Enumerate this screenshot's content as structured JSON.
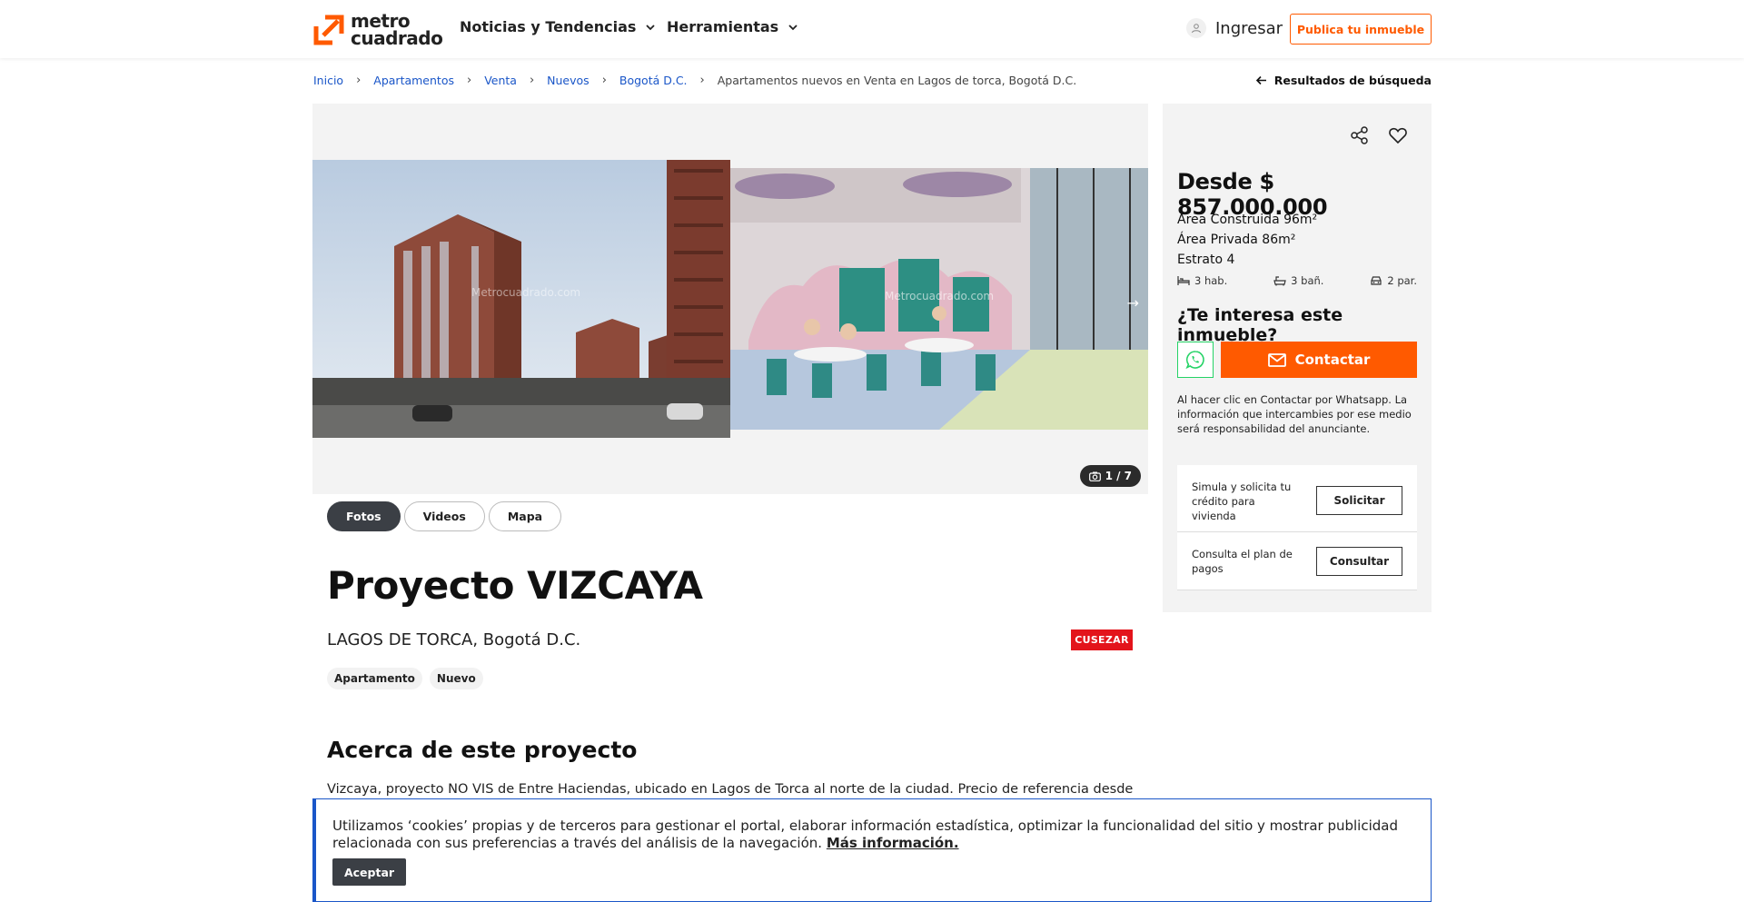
{
  "header": {
    "logo_line1": "metro",
    "logo_line2": "cuadrado",
    "nav": [
      {
        "label": "Noticias y Tendencias"
      },
      {
        "label": "Herramientas"
      }
    ],
    "login_label": "Ingresar",
    "publish_label": "Publica tu inmueble"
  },
  "breadcrumb": {
    "items": [
      "Inicio",
      "Apartamentos",
      "Venta",
      "Nuevos",
      "Bogotá D.C."
    ],
    "separator": "›",
    "current": "Apartamentos nuevos en Venta en Lagos de torca, Bogotá D.C.",
    "back_label": "Resultados de búsqueda"
  },
  "gallery": {
    "counter": "1 / 7",
    "watermark": "Metrocuadrado.com"
  },
  "tabs": [
    {
      "label": "Fotos",
      "active": true
    },
    {
      "label": "Videos",
      "active": false
    },
    {
      "label": "Mapa",
      "active": false
    }
  ],
  "project": {
    "title": "Proyecto VIZCAYA",
    "location": "LAGOS DE TORCA, Bogotá D.C.",
    "builder_logo": "CUSEZAR",
    "chips": [
      "Apartamento",
      "Nuevo"
    ],
    "about_title": "Acerca de este proyecto",
    "about_text": "Vizcaya, proyecto NO VIS de Entre Haciendas, ubicado en Lagos de Torca al norte de la ciudad. Precio de referencia desde"
  },
  "sidebar": {
    "price": "Desde $ 857.000.000",
    "area_construida": "Área Construida 96m²",
    "area_privada": "Área Privada 86m²",
    "estrato": "Estrato 4",
    "features": [
      "3 hab.",
      "3 bañ.",
      "2 par."
    ],
    "interest_title": "¿Te interesa este inmueble?",
    "contact_label": "Contactar",
    "disclaimer": "Al hacer clic en Contactar por Whatsapp. La información que intercambies por ese medio será responsabilidad del anunciante.",
    "credit_text": "Simula y solicita tu crédito para vivienda",
    "credit_button": "Solicitar",
    "plan_text": "Consulta el plan de pagos",
    "plan_button": "Consultar"
  },
  "cookie": {
    "text": "Utilizamos ‘cookies’ propias y de terceros para gestionar el portal, elaborar información estadística, optimizar la funcionalidad del sitio y mostrar publicidad relacionada con sus preferencias a través del análisis de la navegación.",
    "link": "Más información.",
    "accept": "Aceptar"
  },
  "colors": {
    "brand_orange": "#ff5a00",
    "link_blue": "#1a56c8",
    "whatsapp_green": "#25d366",
    "builder_red": "#e3141b"
  }
}
